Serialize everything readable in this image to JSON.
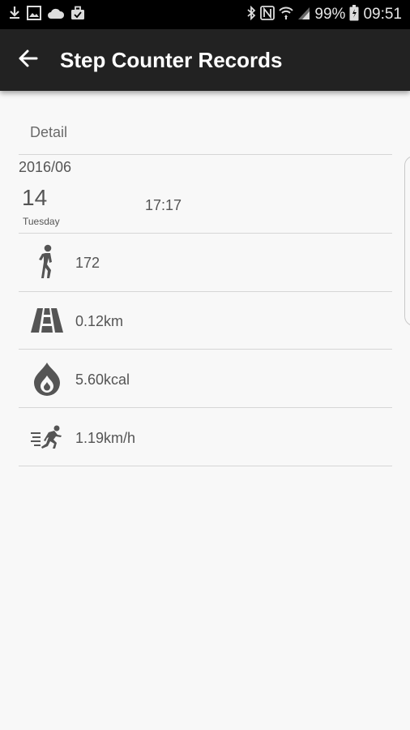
{
  "status_bar": {
    "battery_percent": "99%",
    "time": "09:51",
    "left_icons": [
      "download-icon",
      "image-icon",
      "cloud-icon",
      "briefcase-icon"
    ],
    "right_icons": [
      "bluetooth-icon",
      "nfc-icon",
      "wifi-icon",
      "signal-icon",
      "battery-icon"
    ]
  },
  "app_bar": {
    "title": "Step Counter Records",
    "back_icon": "arrow-left-icon"
  },
  "detail": {
    "label": "Detail",
    "year_month": "2016/06",
    "day": "14",
    "weekday": "Tuesday",
    "time": "17:17"
  },
  "stats": [
    {
      "icon": "walking-person-icon",
      "value": "172"
    },
    {
      "icon": "road-icon",
      "value": "0.12km"
    },
    {
      "icon": "flame-icon",
      "value": "5.60kcal"
    },
    {
      "icon": "running-speed-icon",
      "value": "1.19km/h"
    }
  ],
  "colors": {
    "app_bar": "#222222",
    "status_bar": "#000000",
    "background": "#f8f8f8",
    "text": "#555555",
    "icon": "#555555"
  }
}
